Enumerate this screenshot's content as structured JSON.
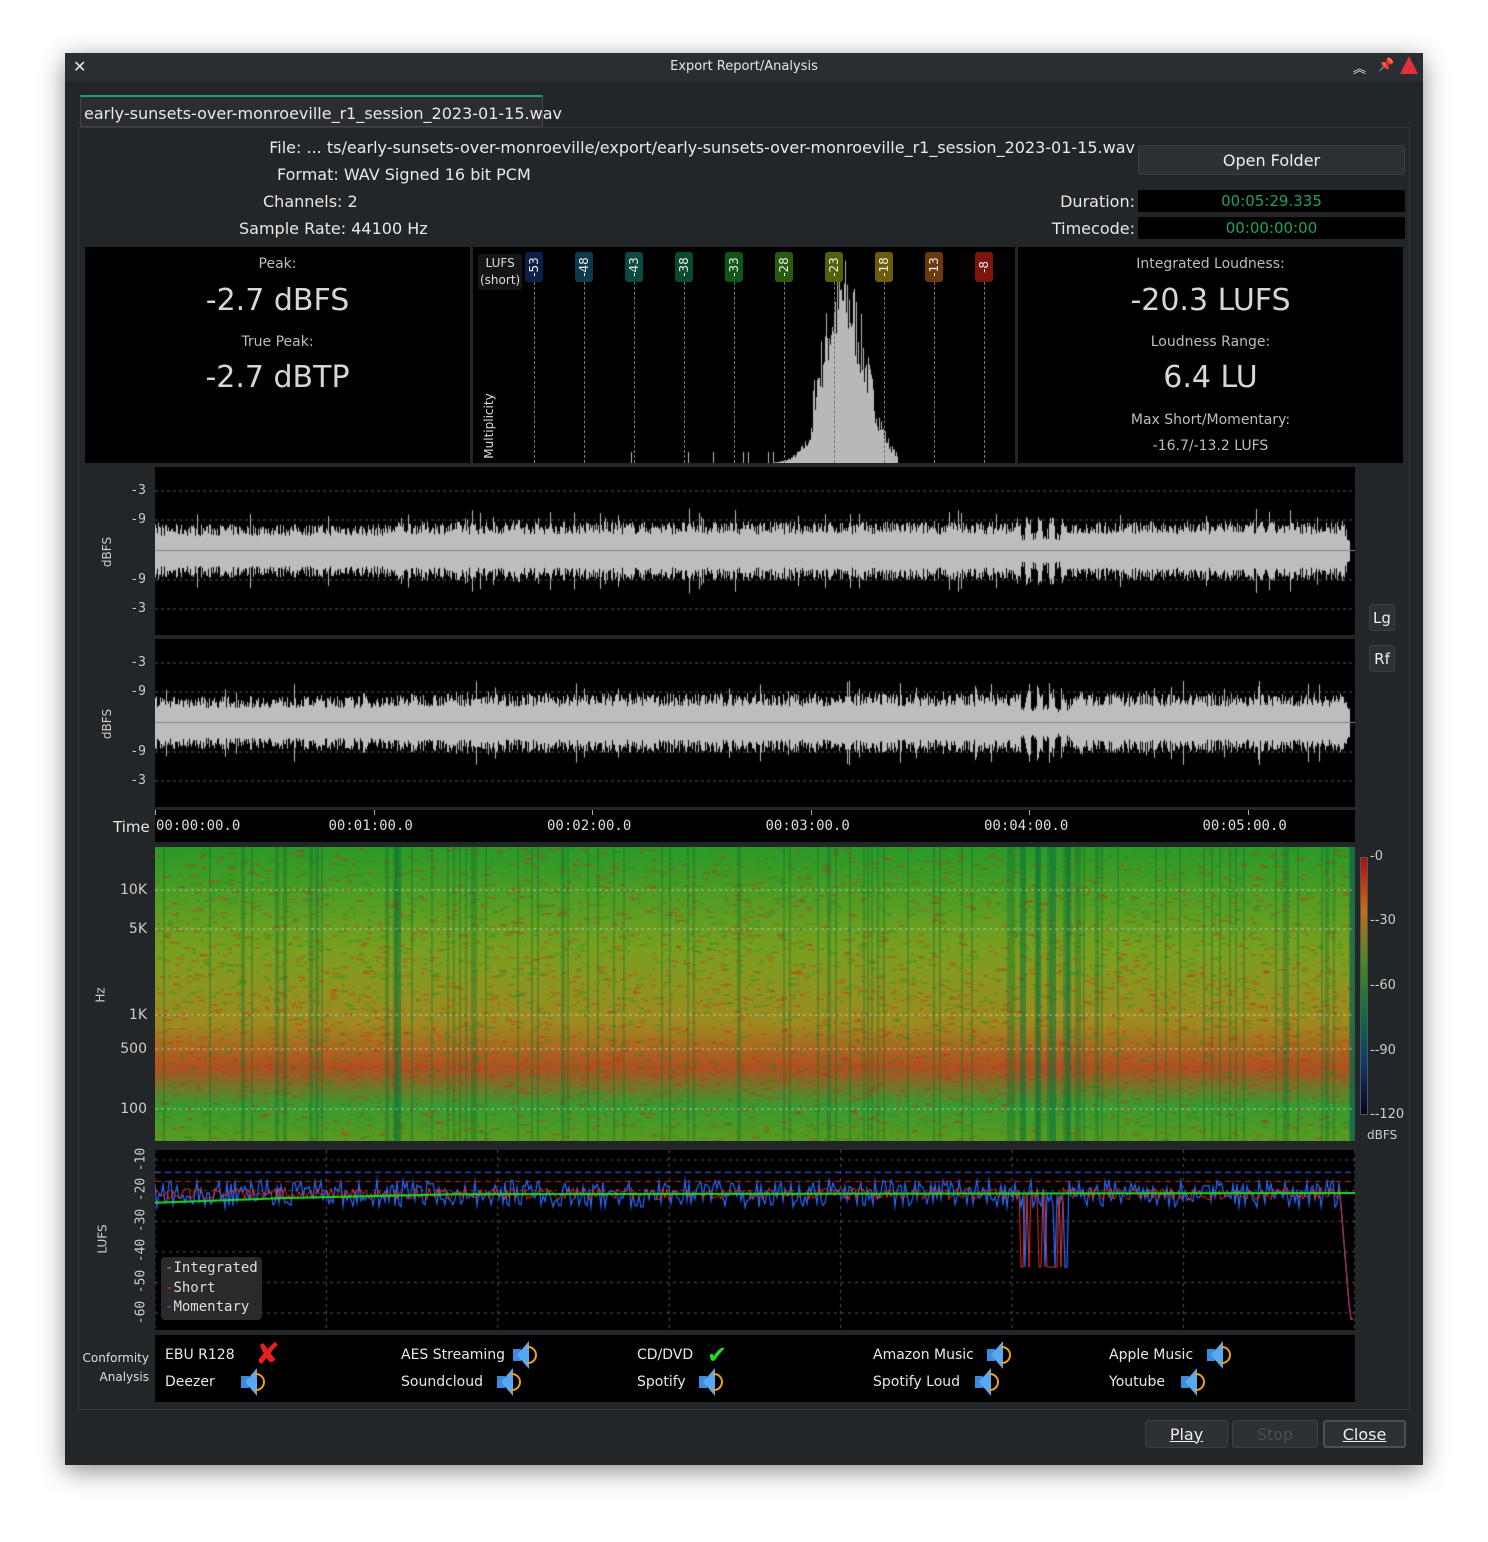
{
  "window": {
    "title": "Export Report/Analysis"
  },
  "tab": {
    "label": "early-sunsets-over-monroeville_r1_session_2023-01-15.wav"
  },
  "info": {
    "file": "File: ... ts/early-sunsets-over-monroeville/export/early-sunsets-over-monroeville_r1_session_2023-01-15.wav",
    "format": "Format: WAV Signed 16 bit PCM",
    "channels": "Channels: 2",
    "sample_rate": "Sample Rate: 44100 Hz",
    "open_folder": "Open Folder",
    "duration_label": "Duration:",
    "duration": "00:05:29.335",
    "timecode_label": "Timecode:",
    "timecode": "00:00:00:00"
  },
  "peak": {
    "peak_label": "Peak:",
    "peak": "-2.7 dBFS",
    "true_peak_label": "True Peak:",
    "true_peak": "-2.7 dBTP"
  },
  "histogram": {
    "title": "LUFS",
    "subtitle": "(short)",
    "ylabel": "Multiplicity",
    "ticks": [
      {
        "v": "-53",
        "c": "#0b1f4a"
      },
      {
        "v": "-48",
        "c": "#0c3a4a"
      },
      {
        "v": "-43",
        "c": "#0b4a44"
      },
      {
        "v": "-38",
        "c": "#0b4a2c"
      },
      {
        "v": "-33",
        "c": "#0e5614"
      },
      {
        "v": "-28",
        "c": "#2a5a0c"
      },
      {
        "v": "-23",
        "c": "#52600c"
      },
      {
        "v": "-18",
        "c": "#6a5c0c"
      },
      {
        "v": "-13",
        "c": "#6a3a0c"
      },
      {
        "v": "-8",
        "c": "#7a160c"
      }
    ]
  },
  "loudness": {
    "integrated_label": "Integrated Loudness:",
    "integrated": "-20.3 LUFS",
    "range_label": "Loudness Range:",
    "range": "6.4 LU",
    "max_label": "Max Short/Momentary:",
    "max": "-16.7/-13.2 LUFS"
  },
  "waveform": {
    "ylabel": "dBFS",
    "ticks": [
      "-3",
      "-9",
      "-9",
      "-3"
    ],
    "log_button": "Lg",
    "rectified_button": "Rf"
  },
  "timeline": {
    "label": "Time",
    "ticks": [
      "00:00:00.0",
      "00:01:00.0",
      "00:02:00.0",
      "00:03:00.0",
      "00:04:00.0",
      "00:05:00.0"
    ]
  },
  "spectrogram": {
    "ylabel": "Hz",
    "ticks": [
      "10K",
      "5K",
      "1K",
      "500",
      "100"
    ],
    "scale": [
      "0",
      "-30",
      "-60",
      "-90",
      "-120"
    ],
    "scale_unit": "dBFS"
  },
  "loudness_graph": {
    "ylabel": "LUFS",
    "ticks": [
      "-10",
      "-20",
      "-30",
      "-40",
      "-50",
      "-60"
    ],
    "legend": [
      {
        "name": "Integrated",
        "color": "#22dd22"
      },
      {
        "name": "Short",
        "color": "#e03020"
      },
      {
        "name": "Momentary",
        "color": "#2a6aff"
      }
    ]
  },
  "conformity": {
    "label1": "Conformity",
    "label2": "Analysis",
    "items": [
      {
        "name": "EBU R128",
        "status": "fail"
      },
      {
        "name": "Deezer",
        "status": "neutral"
      },
      {
        "name": "AES Streaming",
        "status": "neutral"
      },
      {
        "name": "Soundcloud",
        "status": "neutral"
      },
      {
        "name": "CD/DVD",
        "status": "pass"
      },
      {
        "name": "Spotify",
        "status": "neutral"
      },
      {
        "name": "Amazon Music",
        "status": "neutral"
      },
      {
        "name": "Spotify Loud",
        "status": "neutral"
      },
      {
        "name": "Apple Music",
        "status": "neutral"
      },
      {
        "name": "Youtube",
        "status": "neutral"
      }
    ]
  },
  "buttons": {
    "play": "Play",
    "stop": "Stop",
    "close": "Close"
  }
}
